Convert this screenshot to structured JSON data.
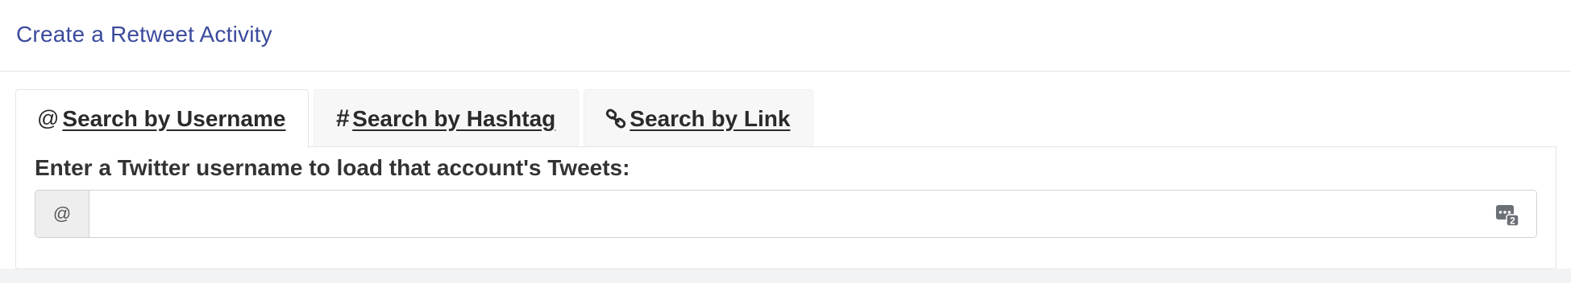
{
  "header": {
    "title": "Create a Retweet Activity"
  },
  "tabs": [
    {
      "icon": "at-icon",
      "icon_glyph": "@",
      "label": "Search by Username",
      "active": true
    },
    {
      "icon": "hashtag-icon",
      "icon_glyph": "#",
      "label": "Search by Hashtag",
      "active": false
    },
    {
      "icon": "link-icon",
      "icon_glyph": "",
      "label": "Search by Link",
      "active": false
    }
  ],
  "username_panel": {
    "label": "Enter a Twitter username to load that account's Tweets:",
    "addon": "@",
    "input_value": "",
    "input_placeholder": "",
    "field_icon": "password-manager-icon"
  },
  "colors": {
    "title": "#3b4a9c",
    "background": "#f2f3f5"
  }
}
